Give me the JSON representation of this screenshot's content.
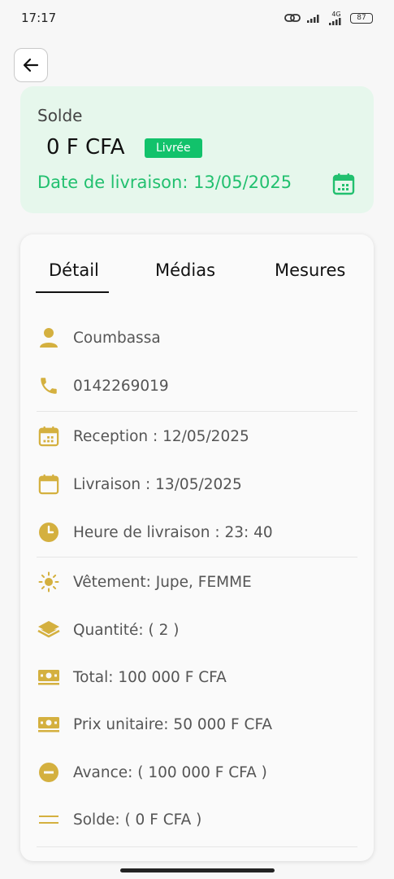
{
  "status": {
    "time": "17:17",
    "network": "4G",
    "battery": "87"
  },
  "balance_card": {
    "label": "Solde",
    "amount": "0 F CFA",
    "badge": "Livrée",
    "delivery_date": "Date de livraison: 13/05/2025"
  },
  "tabs": [
    "Détail",
    "Médias",
    "Mesures"
  ],
  "details": {
    "client": "Coumbassa",
    "phone": "0142269019",
    "reception": "Reception : 12/05/2025",
    "livraison": "Livraison : 13/05/2025",
    "heure": "Heure de livraison : 23: 40",
    "vetement": "Vêtement: Jupe, FEMME",
    "quantite": "Quantité: ( 2 )",
    "total": "Total: 100 000 F CFA",
    "prix_unitaire": "Prix unitaire: 50 000 F CFA",
    "avance": "Avance: ( 100 000 F CFA )",
    "solde": "Solde: ( 0 F CFA )"
  },
  "colors": {
    "accent_green": "#22c06f",
    "badge_green": "#12c26b",
    "icon_gold": "#d4b03f",
    "card_bg": "#e6f7ec"
  },
  "icons": [
    "arrow-left-icon",
    "calendar-icon",
    "person-icon",
    "phone-icon",
    "calendar-icon",
    "calendar-icon",
    "clock-icon",
    "sun-icon",
    "layers-icon",
    "money-icon",
    "money-icon",
    "minus-circle-icon",
    "equals-icon"
  ]
}
